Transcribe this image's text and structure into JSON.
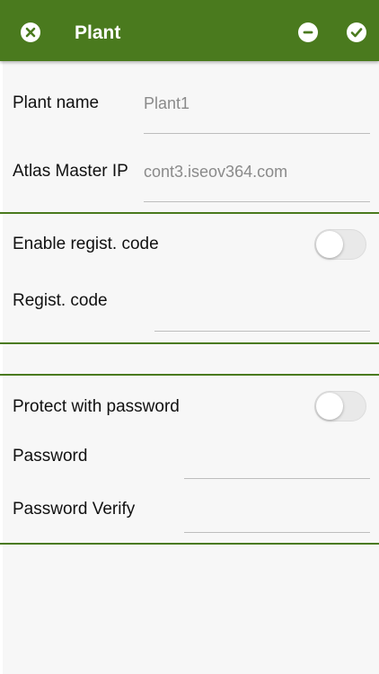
{
  "header": {
    "title": "Plant",
    "close_icon": "close-circle-icon",
    "remove_icon": "minus-circle-icon",
    "confirm_icon": "check-circle-icon",
    "background": "#4a7a1e"
  },
  "form": {
    "plant_name": {
      "label": "Plant name",
      "value": "Plant1"
    },
    "atlas_master_ip": {
      "label": "Atlas Master IP",
      "value": "cont3.iseov364.com"
    },
    "enable_regist_code": {
      "label": "Enable regist. code",
      "enabled": false
    },
    "regist_code": {
      "label": "Regist. code",
      "value": ""
    },
    "protect_with_password": {
      "label": "Protect with password",
      "enabled": false
    },
    "password": {
      "label": "Password",
      "value": ""
    },
    "password_verify": {
      "label": "Password Verify",
      "value": ""
    }
  }
}
